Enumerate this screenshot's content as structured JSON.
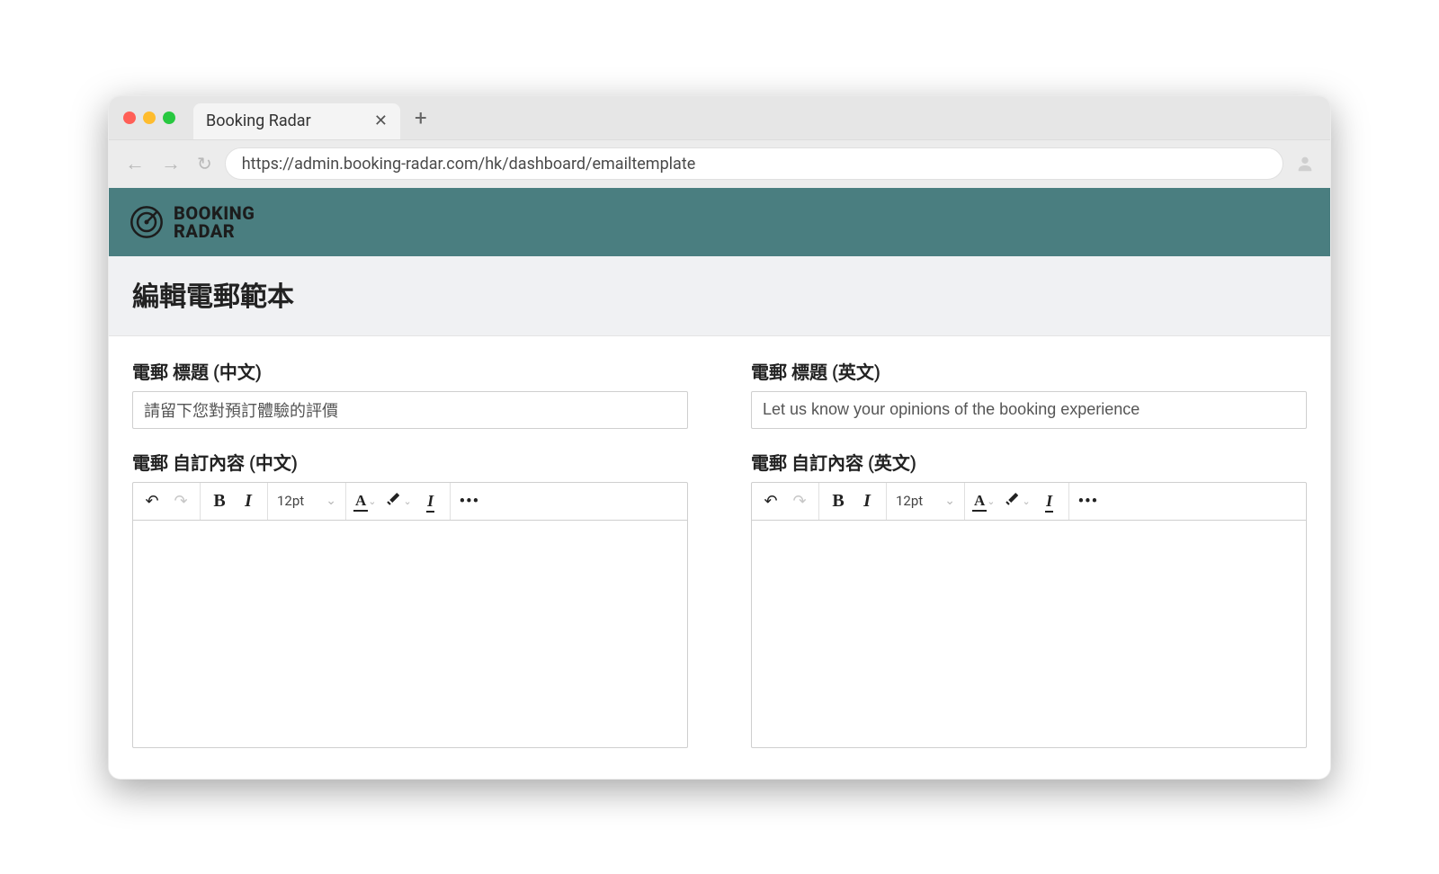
{
  "browser": {
    "tab_title": "Booking Radar",
    "url": "https://admin.booking-radar.com/hk/dashboard/emailtemplate"
  },
  "brand": {
    "line1": "BOOKING",
    "line2": "RADAR"
  },
  "page": {
    "title": "編輯電郵範本"
  },
  "form": {
    "zh": {
      "title_label": "電郵 標題 (中文)",
      "title_value": "請留下您對預訂體驗的評價",
      "content_label": "電郵 自訂內容 (中文)",
      "content_value": ""
    },
    "en": {
      "title_label": "電郵 標題 (英文)",
      "title_value": "Let us know your opinions of the booking experience",
      "content_label": "電郵 自訂內容 (英文)",
      "content_value": ""
    }
  },
  "editor": {
    "font_size": "12pt"
  }
}
